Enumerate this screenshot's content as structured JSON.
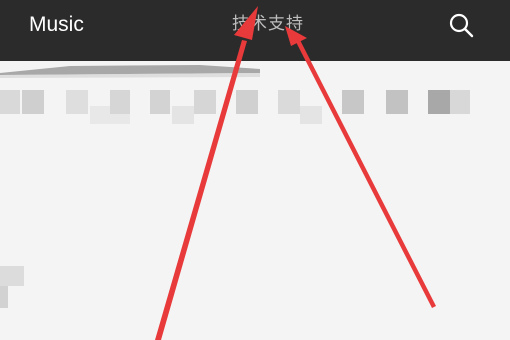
{
  "header": {
    "app_title": "Music",
    "center_tab": "技术支持",
    "search_icon": "search-icon"
  },
  "annotations": {
    "arrow_count": 2,
    "arrow_color": "#e83a3a"
  },
  "colors": {
    "header_bg": "#2b2b2b",
    "title_text": "#ffffff",
    "tab_text": "#bdbdbd",
    "content_bg": "#f4f4f4"
  }
}
